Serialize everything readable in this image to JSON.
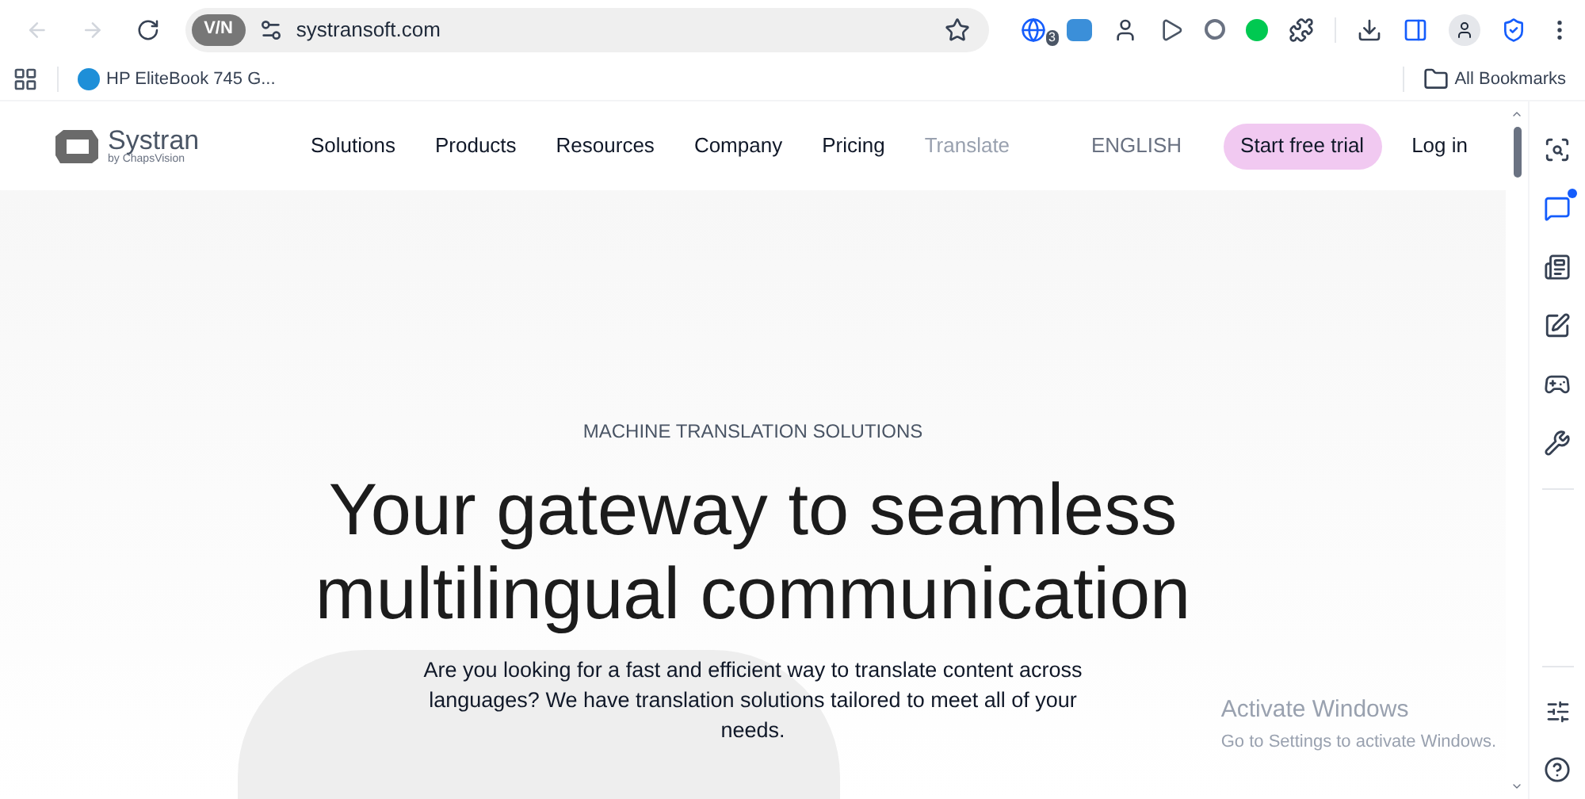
{
  "browser": {
    "vpn_badge": "V/N",
    "url": "systransoft.com",
    "extension_badge": "3",
    "bookmarks": [
      {
        "label": "HP EliteBook 745 G..."
      }
    ],
    "all_bookmarks": "All Bookmarks"
  },
  "site": {
    "logo": {
      "name": "Systran",
      "tagline": "by ChapsVision"
    },
    "nav": [
      {
        "label": "Solutions",
        "muted": false
      },
      {
        "label": "Products",
        "muted": false
      },
      {
        "label": "Resources",
        "muted": false
      },
      {
        "label": "Company",
        "muted": false
      },
      {
        "label": "Pricing",
        "muted": false
      },
      {
        "label": "Translate",
        "muted": true
      }
    ],
    "language": "ENGLISH",
    "cta": "Start free trial",
    "login": "Log in"
  },
  "hero": {
    "eyebrow": "MACHINE TRANSLATION SOLUTIONS",
    "headline": "Your gateway to seamless multilingual communication",
    "body": "Are you looking for a fast and efficient way to translate content across languages? We have translation solutions tailored to meet all of your needs."
  },
  "side_panel": {
    "items": [
      {
        "kind": "search",
        "notify": false
      },
      {
        "kind": "chat",
        "notify": true
      },
      {
        "kind": "news",
        "notify": false
      },
      {
        "kind": "edit",
        "notify": false
      },
      {
        "kind": "games",
        "notify": false
      },
      {
        "kind": "tools",
        "notify": false
      }
    ]
  },
  "os_overlay": {
    "title": "Activate Windows",
    "subtitle": "Go to Settings to activate Windows."
  }
}
